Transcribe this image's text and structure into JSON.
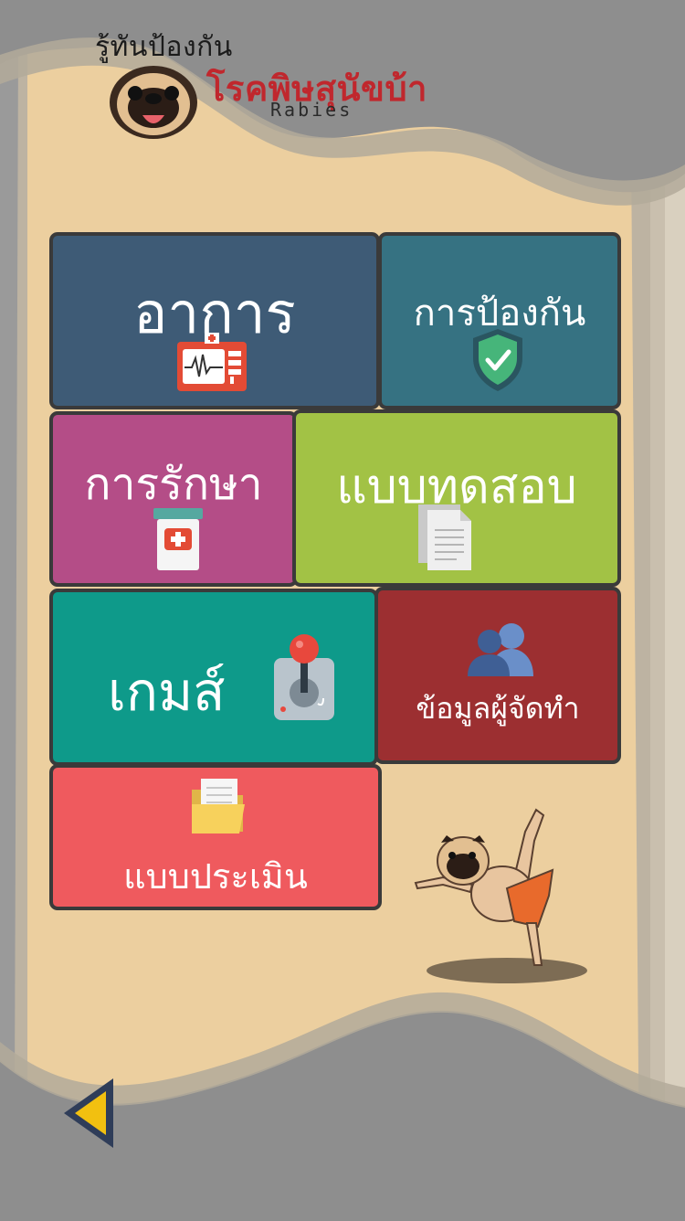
{
  "app": {
    "title_top": "รู้ทันป้องกัน",
    "title_main": "โรคพิษสุนัขบ้า",
    "title_sub": "Rabies"
  },
  "menu": {
    "symptom": {
      "label": "อาการ",
      "icon": "medical-monitor-icon"
    },
    "prevention": {
      "label": "การป้องกัน",
      "icon": "shield-check-icon"
    },
    "treatment": {
      "label": "การรักษา",
      "icon": "medicine-jar-icon"
    },
    "quiz": {
      "label": "แบบทดสอบ",
      "icon": "document-icon"
    },
    "game": {
      "label": "เกมส์",
      "icon": "joystick-icon"
    },
    "credits": {
      "label": "ข้อมูลผู้จัดทำ",
      "icon": "users-icon"
    },
    "evaluation": {
      "label": "แบบประเมิน",
      "icon": "folder-icon"
    }
  },
  "nav": {
    "back_icon": "triangle-left-icon"
  },
  "colors": {
    "page_bg": "#eccf9f",
    "frame_grey": "#8a8a8a",
    "symptom": "#3e5b76",
    "prevention": "#367282",
    "treatment": "#b44d87",
    "quiz": "#a2c245",
    "game": "#0e9a8a",
    "credits": "#9c2f31",
    "evaluation": "#ef5a5e",
    "title_red": "#c0272d"
  }
}
